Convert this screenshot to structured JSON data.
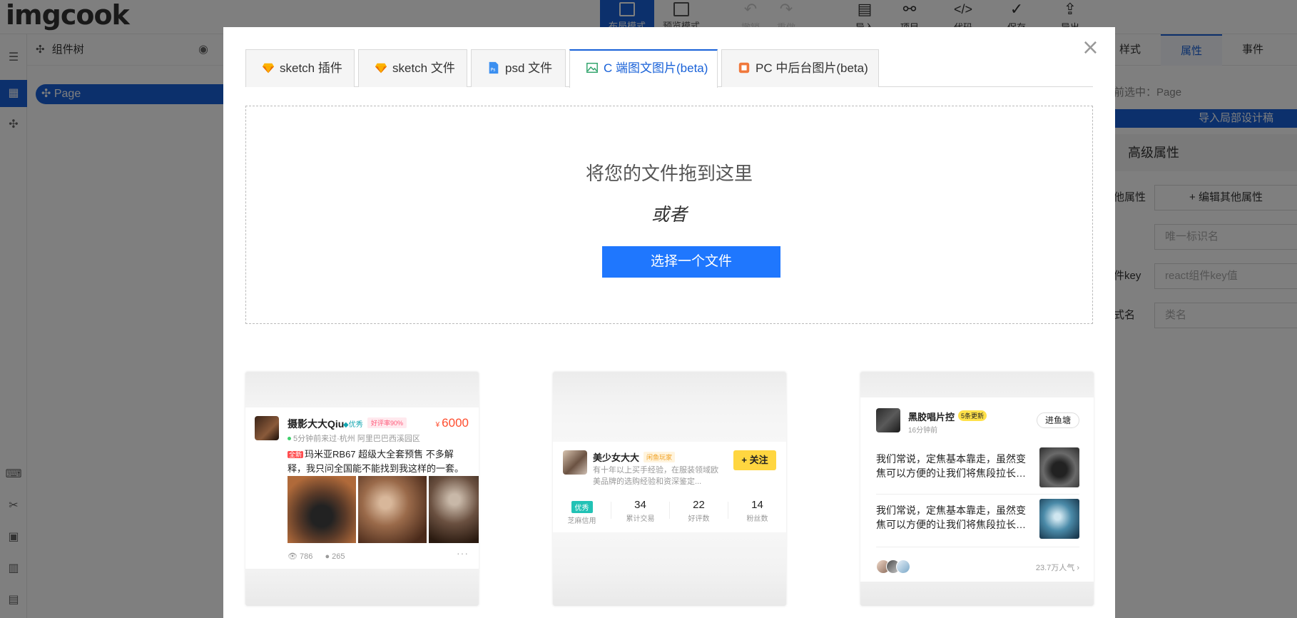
{
  "app": {
    "logo": "imgcook",
    "modes": [
      "布局模式",
      "预览模式"
    ],
    "tools": [
      "撤销",
      "重做",
      "导入",
      "项目",
      "代码",
      "保存",
      "导出"
    ],
    "tool_icons": [
      "undo-icon",
      "redo-icon",
      "import-icon",
      "project-icon",
      "code-icon",
      "save-icon",
      "export-icon"
    ]
  },
  "tree": {
    "title": "组件树",
    "root": "Page"
  },
  "props_panel": {
    "tabs": [
      "样式",
      "属性",
      "事件"
    ],
    "active_tab": "属性",
    "selected": "前选中：Page",
    "import_button": "导入局部设计稿",
    "section": "高级属性",
    "rows": [
      {
        "label": "他属性",
        "value": "+ 编辑其他属性"
      },
      {
        "label": "",
        "placeholder": "唯一标识名"
      },
      {
        "label": "件key",
        "placeholder": "react组件key值"
      },
      {
        "label": "式名",
        "placeholder": "类名"
      }
    ]
  },
  "modal": {
    "tabs": [
      {
        "label": "sketch 插件",
        "icon": "sketch-icon"
      },
      {
        "label": "sketch 文件",
        "icon": "sketch-icon"
      },
      {
        "label": "psd 文件",
        "icon": "psd-icon"
      },
      {
        "label": "C 端图文图片(beta)",
        "icon": "image-icon"
      },
      {
        "label": "PC 中后台图片(beta)",
        "icon": "pc-image-icon"
      }
    ],
    "active_tab": "C 端图文图片(beta)",
    "drop_title": "将您的文件拖到这里",
    "drop_or": "或者",
    "choose_button": "选择一个文件"
  },
  "samples": {
    "card1": {
      "name": "摄影大大Qiu",
      "badge": "优秀",
      "rating": "好评率90%",
      "currency": "¥",
      "price": "6000",
      "meta": "5分钟前来过·杭州 阿里巴巴西溪园区",
      "tag": "全新",
      "desc": "玛米亚RB67 超级大全套预售 不多解释，我只问全国能不能找到我这样的一套。",
      "views": "786",
      "comments": "265",
      "more": "···"
    },
    "card2": {
      "name": "美少女大大",
      "tag": "闲鱼玩家",
      "desc": "有十年以上买手经验，在服装领域欧美品牌的选购经验和资深鉴定...",
      "follow": "+ 关注",
      "credit": "优秀",
      "credit_label": "芝麻信用",
      "stats": [
        {
          "value": "34",
          "label": "累计交易"
        },
        {
          "value": "22",
          "label": "好评数"
        },
        {
          "value": "14",
          "label": "粉丝数"
        }
      ]
    },
    "card3": {
      "name": "黑胶唱片控",
      "update": "5条更新",
      "time": "16分钟前",
      "enter": "进鱼塘",
      "posts": [
        "我们常说，定焦基本靠走，虽然变焦可以方便的让我们将焦段拉长…",
        "我们常说，定焦基本靠走，虽然变焦可以方便的让我们将焦段拉长…"
      ],
      "popularity": "23.7万人气 ›"
    }
  },
  "colors": {
    "brand": "#1861d8",
    "primary_button": "#1f77fe",
    "price": "#ff4d2e",
    "follow": "#ffd640"
  }
}
